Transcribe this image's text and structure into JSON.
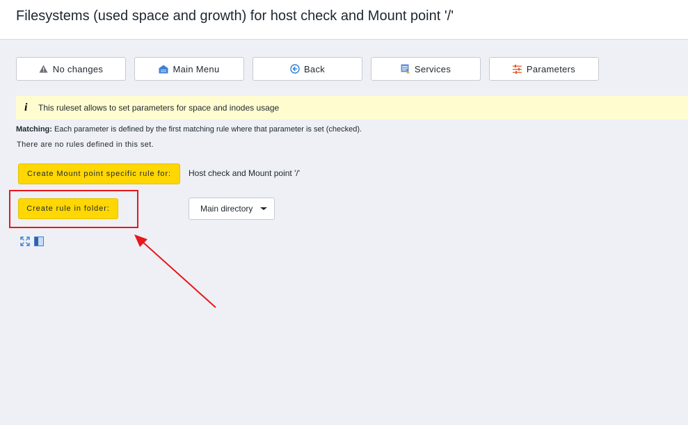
{
  "page": {
    "title": "Filesystems (used space and growth) for host check and Mount point '/'"
  },
  "toolbar": {
    "no_changes": "No changes",
    "main_menu": "Main Menu",
    "back": "Back",
    "services": "Services",
    "parameters": "Parameters"
  },
  "info": {
    "icon": "i",
    "text": "This ruleset allows to set parameters for space and inodes usage"
  },
  "matching": {
    "label": "Matching:",
    "text": " Each parameter is defined by the first matching rule where that parameter is set (checked)."
  },
  "no_rules_text": "There are no rules defined in this set.",
  "create_specific": {
    "button_label": "Create Mount point specific rule for:",
    "target": "Host check and Mount point '/'"
  },
  "create_folder": {
    "button_label": "Create rule in folder:",
    "selected_folder": "Main directory"
  },
  "icons": {
    "no_changes": "warning-icon",
    "main_menu": "home-icon",
    "back": "back-arrow-icon",
    "services": "services-icon",
    "parameters": "parameters-icon",
    "expand": "expand-icon",
    "toggle_sidebar": "sidebar-toggle-icon"
  },
  "colors": {
    "accent_yellow": "#ffd703",
    "info_bg": "#fffdd0",
    "annotation_red": "#e8171c",
    "page_bg": "#eef0f5"
  }
}
